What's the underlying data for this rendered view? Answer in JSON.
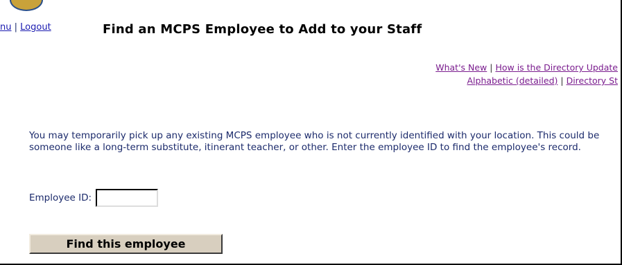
{
  "nav": {
    "menu_fragment": "nu",
    "separator": "|",
    "logout": "Logout"
  },
  "page": {
    "title": "Find an MCPS Employee to Add to your Staff"
  },
  "util_links": {
    "whats_new": "What's New",
    "sep1": "|",
    "how_updated": "How is the Directory Update",
    "alphabetic": "Alphabetic (detailed)",
    "sep2": "|",
    "directory_st": "Directory St"
  },
  "intro": {
    "text": "You may temporarily pick up any existing MCPS employee who is not currently identified with your location. This could be someone like a long-term substitute, itinerant teacher, or other. Enter the employee ID to find the employee's record."
  },
  "form": {
    "employee_id_label": "Employee ID:",
    "employee_id_value": "",
    "submit_label": "Find this employee"
  }
}
